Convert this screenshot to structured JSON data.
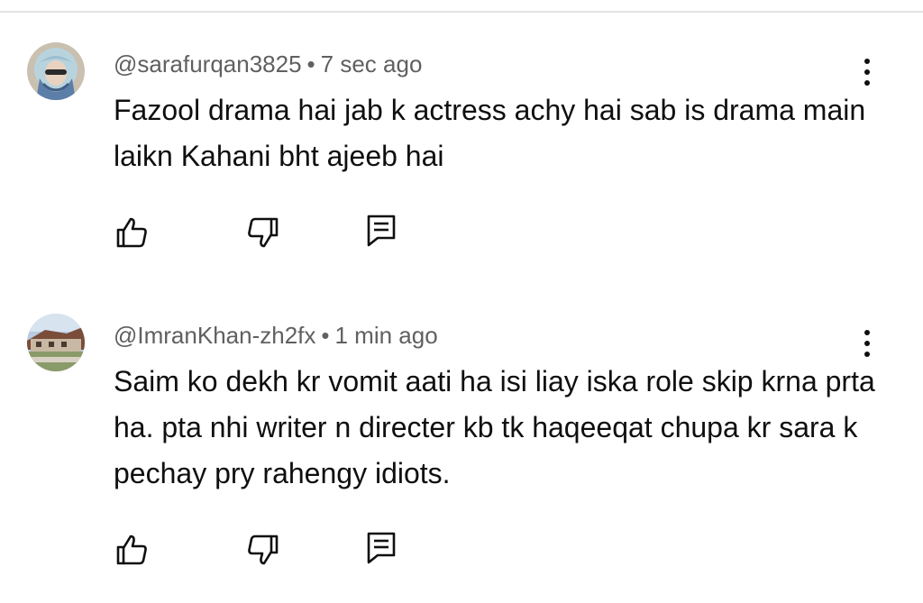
{
  "comments": [
    {
      "author": "@sarafurqan3825",
      "separator": "•",
      "time": "7 sec ago",
      "text": "Fazool drama hai jab k actress achy hai sab is drama main laikn Kahani bht ajeeb hai",
      "avatar_icon": "avatar-girl-with-scarf-icon"
    },
    {
      "author": "@ImranKhan-zh2fx",
      "separator": "•",
      "time": "1 min ago",
      "text": "Saim ko dekh kr vomit aati ha isi liay iska role skip krna prta ha. pta nhi writer n directer kb tk haqeeqat chupa kr sara k pechay pry rahengy idiots.",
      "avatar_icon": "avatar-house-photo-icon"
    }
  ],
  "icons": {
    "like": "thumbs-up-icon",
    "dislike": "thumbs-down-icon",
    "reply": "reply-comment-icon",
    "menu": "more-vertical-icon"
  },
  "colors": {
    "text_primary": "#0f0f0f",
    "text_secondary": "#606060",
    "divider": "#e3e3e3"
  }
}
